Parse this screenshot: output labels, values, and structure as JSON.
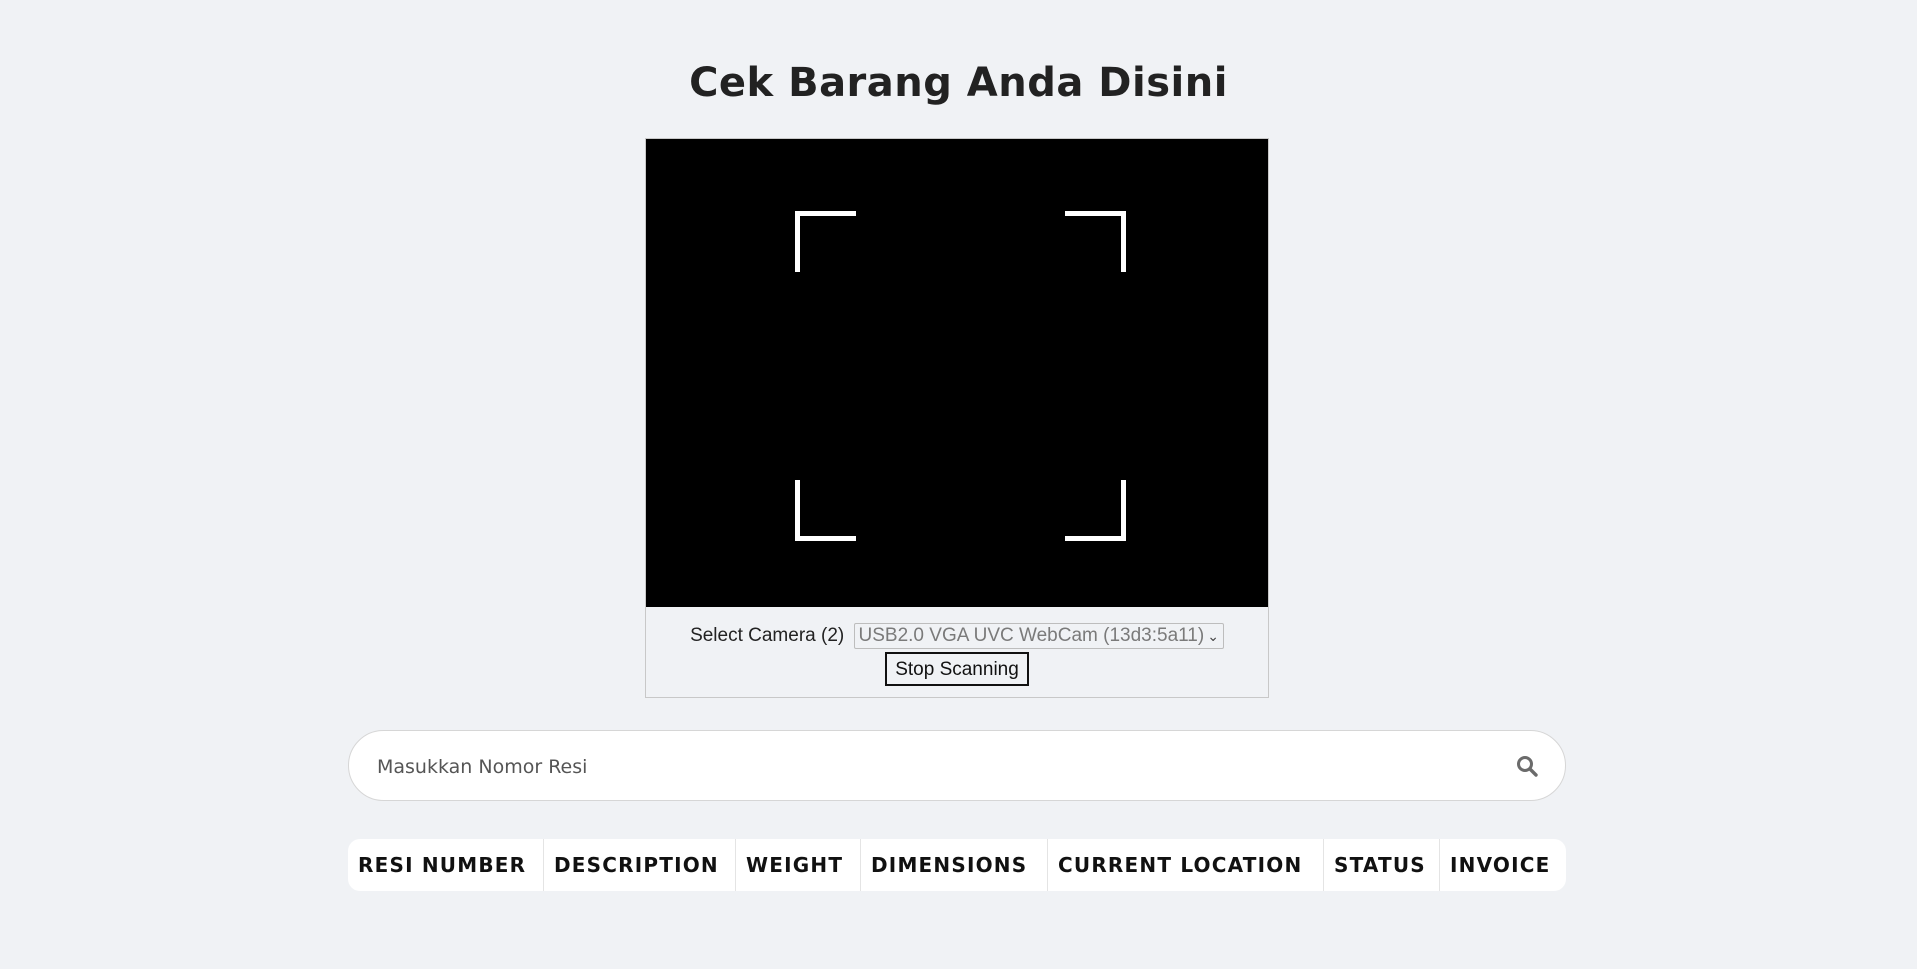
{
  "page": {
    "title": "Cek Barang Anda Disini"
  },
  "scanner": {
    "camera_label": "Select Camera (2)",
    "camera_selected": "USB2.0 VGA UVC WebCam (13d3:5a11)",
    "stop_button_label": "Stop Scanning"
  },
  "search": {
    "placeholder": "Masukkan Nomor Resi",
    "value": "",
    "icon": "search-icon"
  },
  "table": {
    "columns": [
      "RESI NUMBER",
      "DESCRIPTION",
      "WEIGHT",
      "DIMENSIONS",
      "CURRENT LOCATION",
      "STATUS",
      "INVOICE"
    ],
    "rows": []
  },
  "colors": {
    "background": "#f0f2f5",
    "camera_view": "#000000",
    "scan_frame": "#ffffff"
  }
}
